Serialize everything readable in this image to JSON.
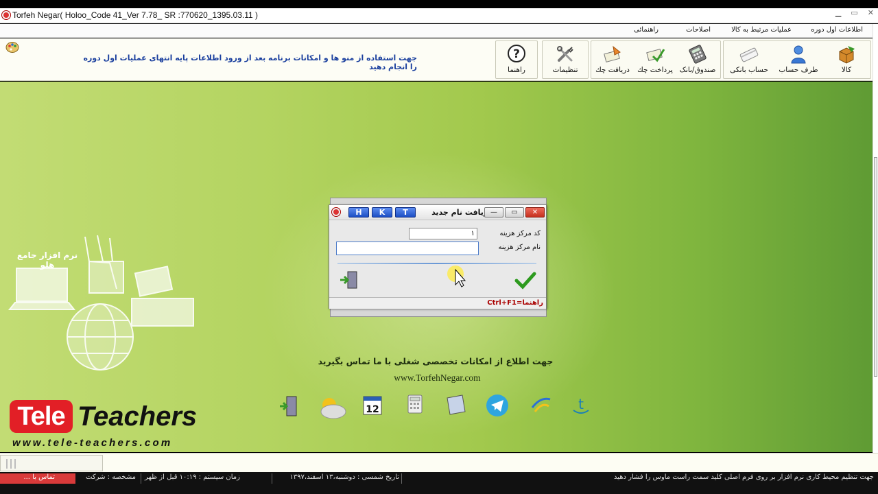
{
  "window": {
    "title": "Torfeh Negar( Holoo_Code 41_Ver 7.78_ SR :770620_1395.03.11 )"
  },
  "menu": [
    {
      "label": "اطلاعات اول دوره"
    },
    {
      "label": "عملیات مرتبط به کالا"
    },
    {
      "label": "اصلاحات"
    },
    {
      "label": "راهنمائی"
    }
  ],
  "toolbar": {
    "hint": "جهت استفاده از منو ها و امکانات برنامه بعد از ورود اطلاعات پایه انتهای عملیات اول دوره را انجام دهید",
    "buttons": [
      {
        "label": "کالا",
        "icon": "box-icon"
      },
      {
        "label": "طرف حساب",
        "icon": "person-icon"
      },
      {
        "label": "حساب بانکی",
        "icon": "bank-card-icon"
      },
      {
        "label": "صندوق/بانک",
        "icon": "calculator-icon"
      },
      {
        "label": "پرداخت چك",
        "icon": "check-payment-icon"
      },
      {
        "label": "دریافت چك",
        "icon": "check-receive-icon"
      },
      {
        "label": "تنظیمات",
        "icon": "tools-icon"
      },
      {
        "label": "راهنما",
        "icon": "help-icon"
      }
    ]
  },
  "desktop": {
    "illustration_caption": "نرم افزار جامع هلو",
    "info_line1": "جهت اطلاع از امکانات تخصصی شغلی با ما تماس بگیرید",
    "info_line2": "www.TorfehNegar.com",
    "brand": {
      "tele": "Tele",
      "teachers": "Teachers",
      "url": "www.tele-teachers.com"
    },
    "dock": [
      {
        "name": "exit-door-icon"
      },
      {
        "name": "weather-icon"
      },
      {
        "name": "calendar-icon",
        "text": "12"
      },
      {
        "name": "calculator-icon"
      },
      {
        "name": "notepad-icon"
      },
      {
        "name": "telegram-icon"
      },
      {
        "name": "website-icon"
      },
      {
        "name": "torfeh-logo-icon"
      }
    ]
  },
  "dialog": {
    "title": "دریافت نام جدید",
    "hotkeys": [
      "H",
      "K",
      "T"
    ],
    "fields": [
      {
        "label": "کد مرکز هزینه",
        "value": "۱"
      },
      {
        "label": "نام مرکز هزینه",
        "value": ""
      }
    ],
    "status": "Ctrl+F1=راهنما"
  },
  "statusbar": {
    "left_red": "تماس با ...",
    "company": "مشخصه : شرکت",
    "time": "زمان سیستم : ۱۰:۱۹ قبل از ظهر",
    "date": "تاریخ شمسی : دوشنبه،۱۳ اسفند،۱۳۹۷",
    "message": "جهت تنظیم محیط کاری نرم افزار بر روی فرم اصلی کلید سمت راست ماوس را فشار دهید"
  },
  "colors": {
    "accent_blue": "#1a3f9e",
    "desktop_green": "#a2c94d",
    "brand_red": "#e21f26"
  }
}
